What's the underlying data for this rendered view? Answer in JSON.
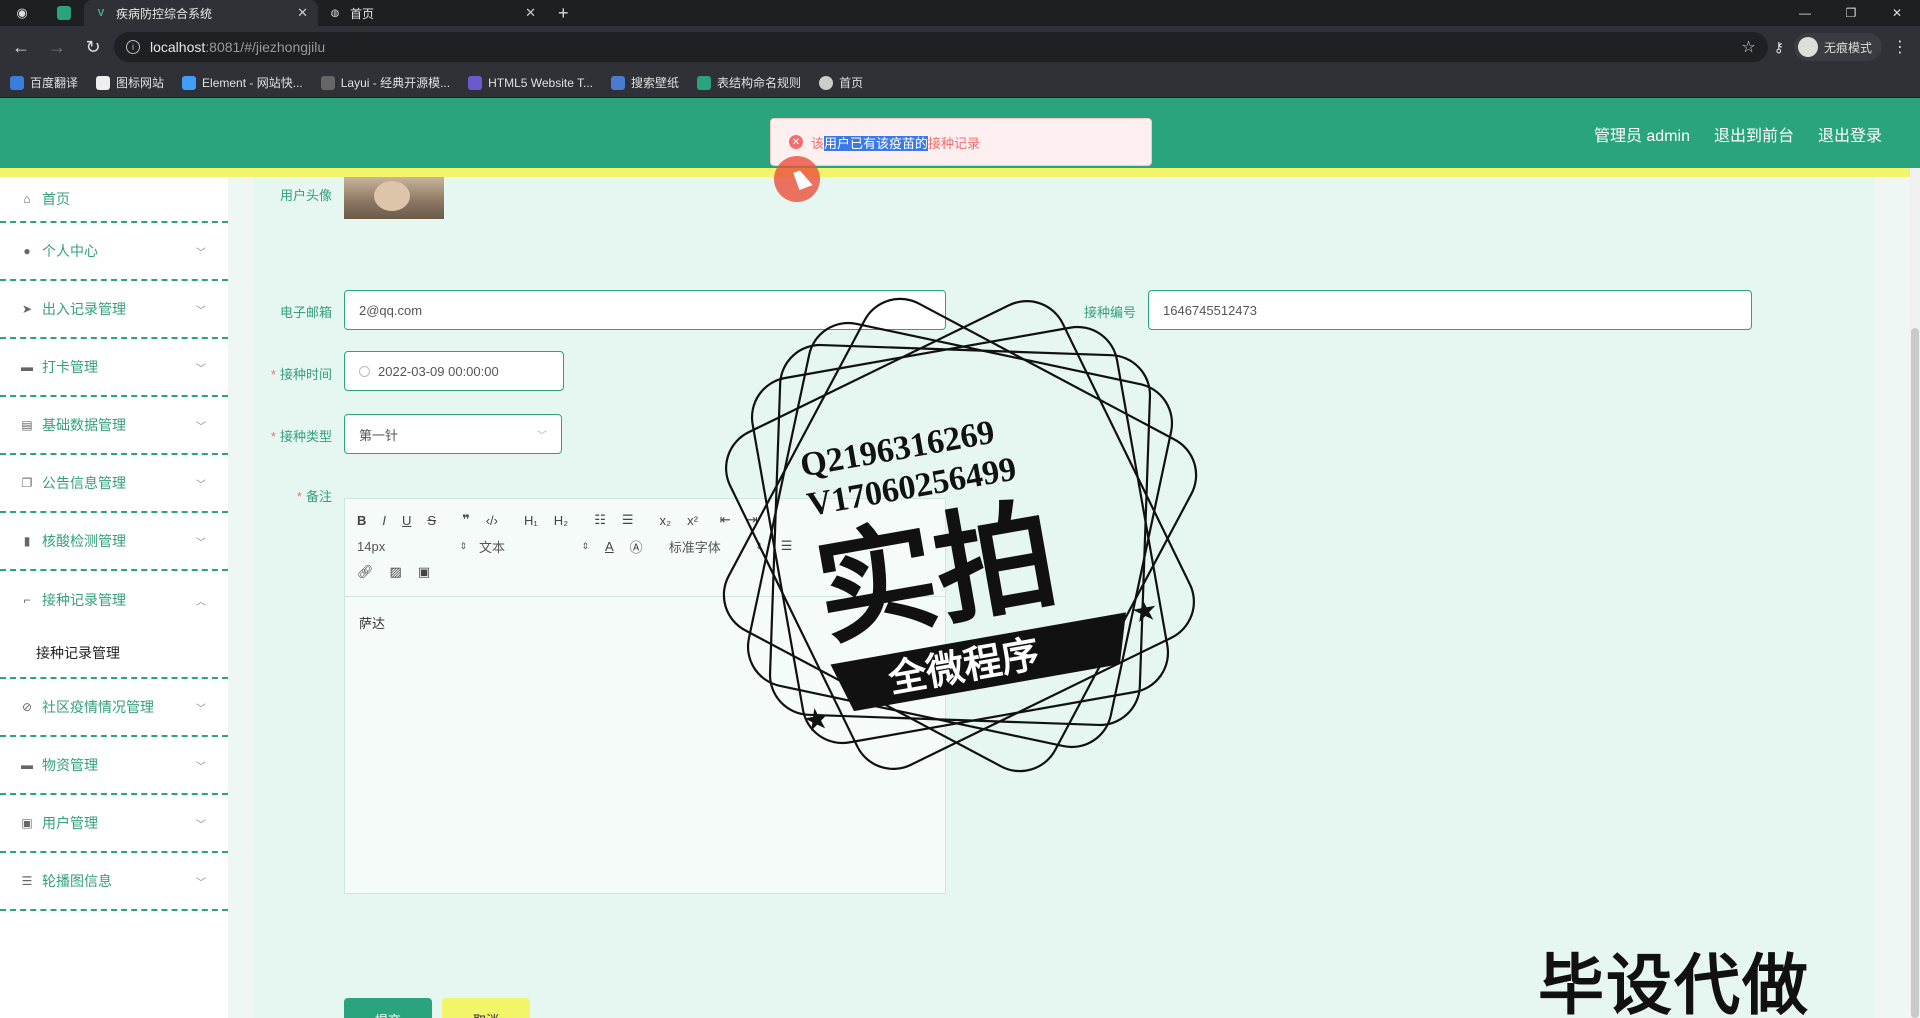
{
  "browser": {
    "tabs": [
      {
        "title": "疾病防控综合系统",
        "active": true
      },
      {
        "title": "首页",
        "active": false
      }
    ],
    "url_host": "localhost",
    "url_path": ":8081/#/jiezhongjilu",
    "incognito_label": "无痕模式",
    "bookmarks": [
      "百度翻译",
      "图标网站",
      "Element - 网站快...",
      "Layui - 经典开源模...",
      "HTML5 Website T...",
      "搜索壁纸",
      "表结构命名规则",
      "首页"
    ]
  },
  "header": {
    "admin_label": "管理员 admin",
    "to_front": "退出到前台",
    "logout": "退出登录"
  },
  "toast": {
    "pre": "该",
    "selected": "用户已有该疫苗的",
    "post": "接种记录"
  },
  "sidebar": {
    "items": [
      {
        "label": "首页",
        "icon": "home-icon"
      },
      {
        "label": "个人中心",
        "icon": "user-icon"
      },
      {
        "label": "出入记录管理",
        "icon": "send-icon"
      },
      {
        "label": "打卡管理",
        "icon": "briefcase-icon"
      },
      {
        "label": "基础数据管理",
        "icon": "clipboard-icon"
      },
      {
        "label": "公告信息管理",
        "icon": "copy-icon"
      },
      {
        "label": "核酸检测管理",
        "icon": "bar-chart-icon"
      },
      {
        "label": "接种记录管理",
        "icon": "crop-icon"
      }
    ],
    "sub_item": "接种记录管理",
    "items_after": [
      {
        "label": "社区疫情情况管理",
        "icon": "bell-off-icon"
      },
      {
        "label": "物资管理",
        "icon": "box-icon"
      },
      {
        "label": "用户管理",
        "icon": "trash-icon"
      },
      {
        "label": "轮播图信息",
        "icon": "sliders-icon"
      }
    ]
  },
  "form": {
    "avatar_label": "用户头像",
    "email_label": "电子邮箱",
    "email_value": "2@qq.com",
    "code_label": "接种编号",
    "code_value": "1646745512473",
    "time_label": "接种时间",
    "time_value": "2022-03-09 00:00:00",
    "type_label": "接种类型",
    "type_value": "第一针",
    "note_label": "备注",
    "editor_size": "14px",
    "editor_text_type": "文本",
    "editor_font": "标准字体",
    "editor_content": "萨达",
    "submit": "提交",
    "cancel": "取消"
  },
  "watermark": {
    "q": "Q2196316269",
    "v": "V17060256499",
    "big": "实拍",
    "ribbon": "全微程序",
    "corner": "毕设代做"
  },
  "colors": {
    "brand": "#2aa47c",
    "accent_yellow": "#f2f56a",
    "error": "#f56c6c"
  }
}
